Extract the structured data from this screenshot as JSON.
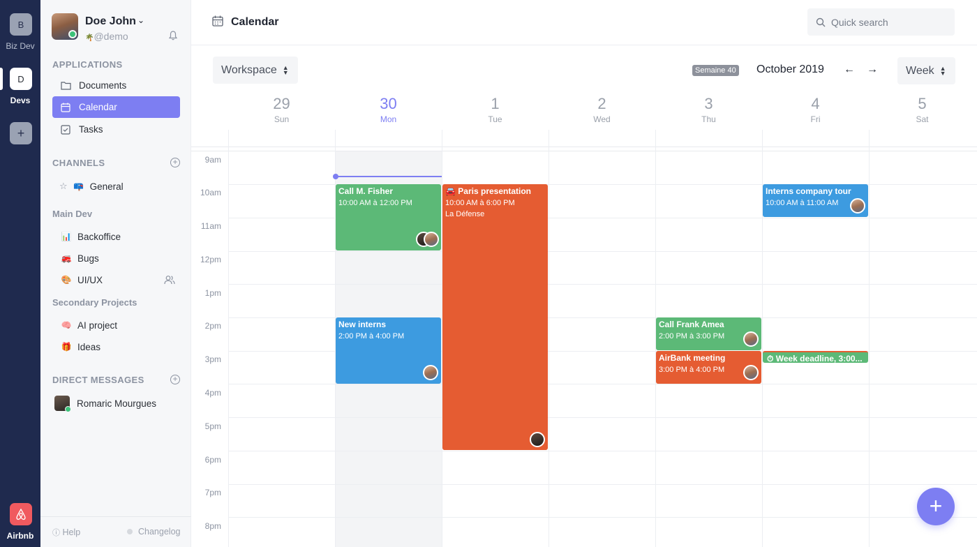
{
  "workspaces": [
    {
      "letter": "B",
      "name": "Biz Dev"
    },
    {
      "letter": "D",
      "name": "Devs"
    },
    {
      "letter": "+",
      "name": ""
    },
    {
      "letter": "",
      "name": "Airbnb"
    }
  ],
  "user": {
    "name": "Doe John",
    "handle": "@demo"
  },
  "sidebar": {
    "applications_title": "APPLICATIONS",
    "apps": [
      {
        "label": "Documents",
        "icon": "folder-icon"
      },
      {
        "label": "Calendar",
        "icon": "calendar-icon"
      },
      {
        "label": "Tasks",
        "icon": "checkbox-icon"
      }
    ],
    "channels_title": "CHANNELS",
    "channels": [
      {
        "label": "General",
        "emoji": "📪"
      }
    ],
    "main_dev_title": "Main Dev",
    "main_dev": [
      {
        "label": "Backoffice",
        "emoji": "📊"
      },
      {
        "label": "Bugs",
        "emoji": "🚒"
      },
      {
        "label": "UI/UX",
        "emoji": "🎨"
      }
    ],
    "secondary_title": "Secondary Projects",
    "secondary": [
      {
        "label": "AI project",
        "emoji": "🧠"
      },
      {
        "label": "Ideas",
        "emoji": "🎁"
      }
    ],
    "dm_title": "DIRECT MESSAGES",
    "dms": [
      {
        "label": "Romaric Mourgues"
      }
    ],
    "help": "Help",
    "changelog": "Changelog"
  },
  "header": {
    "title": "Calendar",
    "search_placeholder": "Quick search"
  },
  "toolbar": {
    "workspace": "Workspace",
    "week_badge": "Semaine 40",
    "month": "October 2019",
    "view": "Week",
    "prev": "←",
    "next": "→"
  },
  "days": [
    {
      "num": "29",
      "name": "Sun"
    },
    {
      "num": "30",
      "name": "Mon"
    },
    {
      "num": "1",
      "name": "Tue"
    },
    {
      "num": "2",
      "name": "Wed"
    },
    {
      "num": "3",
      "name": "Thu"
    },
    {
      "num": "4",
      "name": "Fri"
    },
    {
      "num": "5",
      "name": "Sat"
    }
  ],
  "hours": [
    "9am",
    "10am",
    "11am",
    "12pm",
    "1pm",
    "2pm",
    "3pm",
    "4pm",
    "5pm",
    "6pm",
    "7pm",
    "8pm"
  ],
  "events": [
    {
      "title": "Call M. Fisher",
      "time": "10:00 AM à 12:00 PM",
      "color": "#5cb977"
    },
    {
      "title": "Paris presentation",
      "time": "10:00 AM à 6:00 PM",
      "location": "La Défense",
      "color": "#e55c32"
    },
    {
      "title": "Interns company tour",
      "time": "10:00 AM à 11:00 AM",
      "color": "#3d9be0"
    },
    {
      "title": "New interns",
      "time": "2:00 PM à 4:00 PM",
      "color": "#3d9be0"
    },
    {
      "title": "Call Frank Amea",
      "time": "2:00 PM à 3:00 PM",
      "color": "#5cb977"
    },
    {
      "title": "AirBank meeting",
      "time": "3:00 PM à 4:00 PM",
      "color": "#e55c32"
    },
    {
      "title": "Week deadline, 3:00...",
      "color": "#5cb977"
    }
  ],
  "accent": "#7d7ef2"
}
